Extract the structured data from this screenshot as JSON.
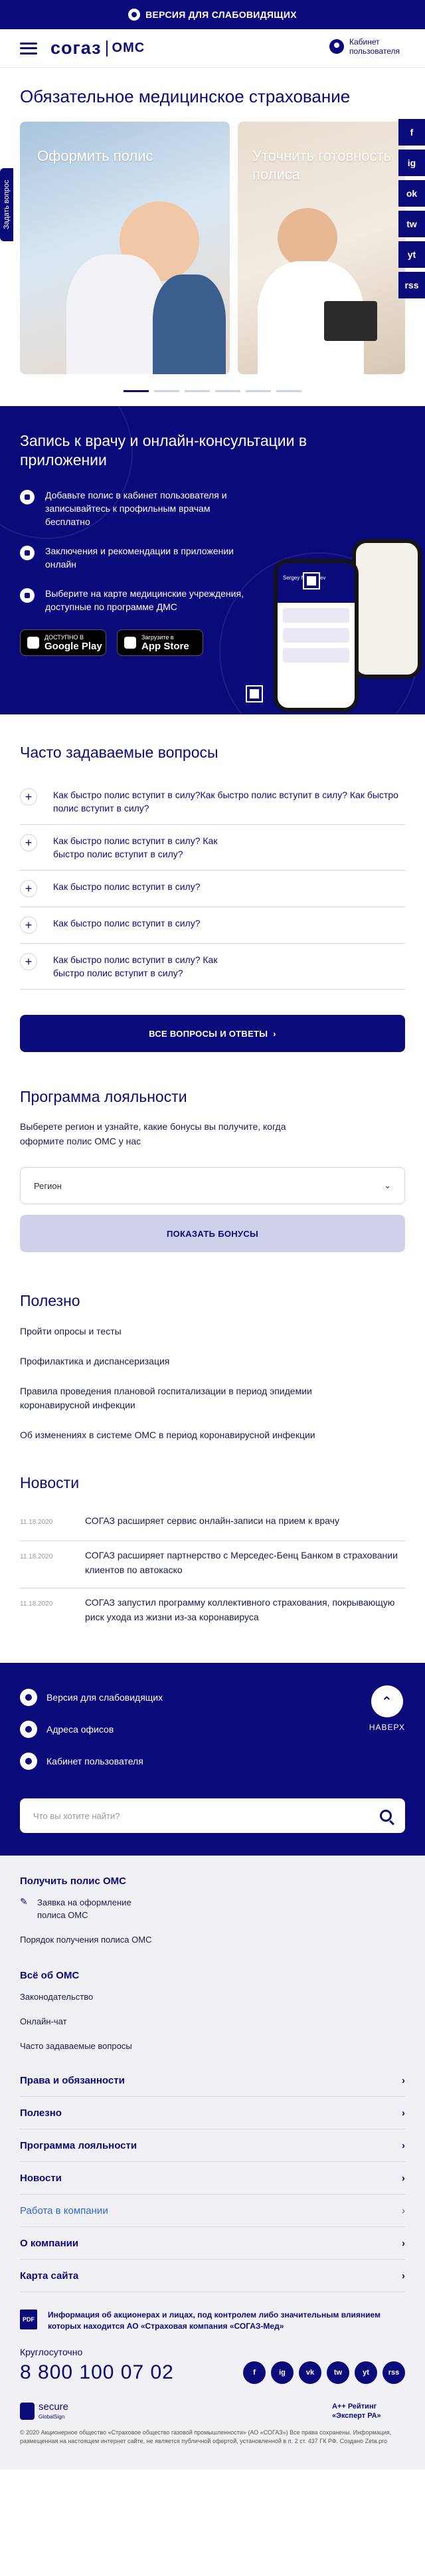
{
  "topbar": {
    "label": "ВЕРСИЯ ДЛЯ СЛАБОВИДЯЩИХ"
  },
  "header": {
    "logo_main": "согаз",
    "logo_sub": "ОМС",
    "cabinet": "Кабинет пользователя"
  },
  "page_title": "Обязательное медицинское страхование",
  "side_tab": "Задать вопрос",
  "social_side": [
    "f",
    "ig",
    "ok",
    "tw",
    "yt",
    "rss"
  ],
  "hero": {
    "card1": "Оформить полис",
    "card2": "Уточнить готовность полиса"
  },
  "app_section": {
    "title": "Запись к врачу и онлайн-консультации в приложении",
    "items": [
      "Добавьте полис в кабинет пользователя и записывайтесь к профильным врачам бесплатно",
      "Заключения и рекомендации в приложении онлайн",
      "Выберите на карте медицинские учреждения, доступные по программе ДМС"
    ],
    "google_small": "ДОСТУПНО В",
    "google_big": "Google Play",
    "apple_small": "Загрузите в",
    "apple_big": "App Store",
    "phone_greeting": "Sergey Medvedev"
  },
  "faq": {
    "title": "Часто задаваемые вопросы",
    "items": [
      "Как быстро полис вступит в силу?Как быстро полис вступит в силу? Как быстро полис вступит в силу?",
      "Как быстро полис вступит в силу? Как быстро полис вступит в силу?",
      "Как быстро полис вступит в силу?",
      "Как быстро полис вступит в силу?",
      "Как быстро полис вступит в силу? Как быстро полис вступит в силу?"
    ],
    "all_button": "ВСЕ ВОПРОСЫ И ОТВЕТЫ"
  },
  "loyalty": {
    "title": "Программа лояльности",
    "text": "Выберете регион и узнайте, какие бонусы вы получите, когда оформите полис ОМС у нас",
    "region_placeholder": "Регион",
    "button": "ПОКАЗАТЬ БОНУСЫ"
  },
  "useful": {
    "title": "Полезно",
    "links": [
      "Пройти опросы и тесты",
      "Профилактика и диспансеризация",
      "Правила проведения плановой госпитализации в период эпидемии коронавирусной инфекции",
      "Об изменениях в системе ОМС в период коронавирусной инфекции"
    ]
  },
  "news": {
    "title": "Новости",
    "items": [
      {
        "date": "11.18.2020",
        "text": "СОГАЗ расширяет сервис онлайн-записи на прием к врачу"
      },
      {
        "date": "11.18.2020",
        "text": "СОГАЗ расширяет партнерство с Мерседес-Бенц Банком в страховании клиентов по автокаско"
      },
      {
        "date": "11.18.2020",
        "text": "СОГАЗ запустил программу коллективного страхования, покрывающую риск ухода из жизни из-за коронавируса"
      }
    ]
  },
  "footer": {
    "links": [
      "Версия для слабовидящих",
      "Адреса офисов",
      "Кабинет пользователя"
    ],
    "up_label": "НАВЕРХ",
    "search_placeholder": "Что вы хотите найти?"
  },
  "menu": {
    "group1_title": "Получить полис ОМС",
    "group1_items": [
      "Заявка на оформление полиса ОМС",
      "Порядок получения полиса ОМС"
    ],
    "group2_title": "Всё об ОМС",
    "group2_items": [
      "Законодательство",
      "Онлайн-чат",
      "Часто задаваемые вопросы"
    ],
    "accordion": [
      "Права и обязанности",
      "Полезно",
      "Программа лояльности",
      "Новости",
      "Работа в компании",
      "О компании",
      "Карта сайта"
    ],
    "info": "Информация об акционерах и лицах, под контролем либо значительным влиянием которых находится АО «Страховая компания «СОГАЗ-Мед»",
    "pdf": "PDF",
    "hotline_label": "Круглосуточно",
    "hotline": "8 800 100 07 02",
    "socials": [
      "f",
      "ig",
      "vk",
      "tw",
      "yt",
      "rss"
    ],
    "secure_top": "secure",
    "secure_bottom": "GlobalSign",
    "rating": "A++ Рейтинг «Эксперт РА»",
    "copyright": "© 2020 Акционерное общество «Страховое общество газовой промышленности» (АО «СОГАЗ») Все права сохранены. Информация, размещенная на настоящем интернет сайте, не является публичной офертой, установленной в п. 2 ст. 437 ГК РФ. Создано Zeta.pro"
  }
}
